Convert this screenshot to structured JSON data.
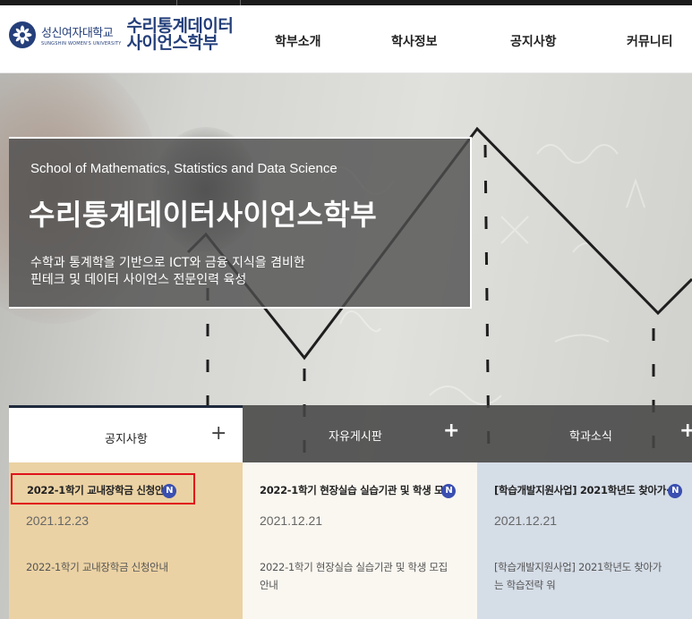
{
  "header": {
    "university_ko": "성신여자대학교",
    "university_en": "SUNGSHIN WOMEN'S UNIVERSITY",
    "dept_line1": "수리통계데이터",
    "dept_line2": "사이언스학부",
    "nav": [
      {
        "label": "학부소개"
      },
      {
        "label": "학사정보"
      },
      {
        "label": "공지사항"
      },
      {
        "label": "커뮤니티"
      }
    ]
  },
  "hero": {
    "subtitle_en": "School of Mathematics, Statistics and Data Science",
    "title": "수리통계데이터사이언스학부",
    "desc_line1": "수학과 통계학을 기반으로 ICT와 금융 지식을 겸비한",
    "desc_line2": "핀테크 및 데이터 사이언스 전문인력 육성"
  },
  "tabs": [
    {
      "label": "공지사항",
      "plus": "+"
    },
    {
      "label": "자유게시판",
      "plus": "+"
    },
    {
      "label": "학과소식",
      "plus": "+"
    }
  ],
  "cards": [
    {
      "title": "2022-1학기 교내장학금 신청안",
      "badge": "N",
      "date": "2021.12.23",
      "desc_line1": "2022-1학기 교내장학금 신청안내",
      "desc_line2": ""
    },
    {
      "title": "2022-1학기 현장실습 실습기관 및 학생 모",
      "badge": "N",
      "date": "2021.12.21",
      "desc_line1": "2022-1학기 현장실습 실습기관 및 학생 모집",
      "desc_line2": "안내"
    },
    {
      "title": "[학습개발지원사업] 2021학년도 찾아가·",
      "badge": "N",
      "date": "2021.12.21",
      "desc_line1": "[학습개발지원사업] 2021학년도 찾아가",
      "desc_line2": "는 학습전략 워"
    }
  ],
  "colors": {
    "brand_navy": "#243f7a",
    "badge_blue": "#3a4fb0",
    "highlight_red": "#e0141a",
    "card1_bg": "#ebd2a4",
    "card2_bg": "#faf7f0",
    "card3_bg": "#d5dde7"
  }
}
